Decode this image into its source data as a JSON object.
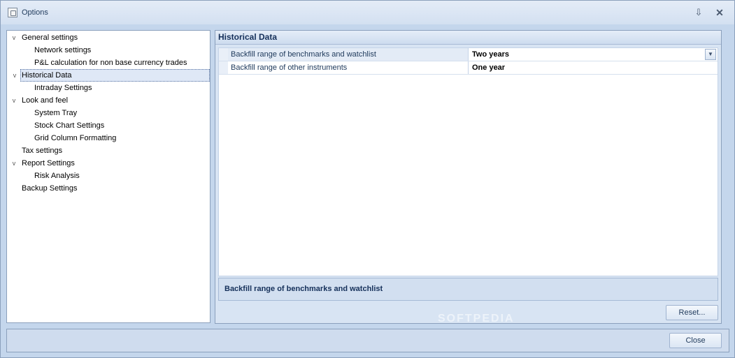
{
  "window": {
    "title": "Options",
    "pin_glyph": "⇩",
    "close_glyph": "✕"
  },
  "tree": {
    "items": [
      {
        "label": "General settings",
        "level": 0,
        "expanded": true
      },
      {
        "label": "Network settings",
        "level": 1
      },
      {
        "label": "P&L calculation for non base currency trades",
        "level": 1
      },
      {
        "label": "Historical Data",
        "level": 0,
        "expanded": true,
        "selected": true
      },
      {
        "label": "Intraday Settings",
        "level": 1
      },
      {
        "label": "Look and feel",
        "level": 0,
        "expanded": true
      },
      {
        "label": "System Tray",
        "level": 1
      },
      {
        "label": "Stock Chart Settings",
        "level": 1
      },
      {
        "label": "Grid Column Formatting",
        "level": 1
      },
      {
        "label": "Tax settings",
        "level": 0
      },
      {
        "label": "Report Settings",
        "level": 0,
        "expanded": true
      },
      {
        "label": "Risk Analysis",
        "level": 1
      },
      {
        "label": "Backup Settings",
        "level": 0
      }
    ],
    "chevron_glyph": "v"
  },
  "panel": {
    "header": "Historical Data",
    "rows": [
      {
        "name": "Backfill range of benchmarks and watchlist",
        "value": "Two years",
        "has_dropdown": true
      },
      {
        "name": "Backfill range of other instruments",
        "value": "One year",
        "has_dropdown": false
      }
    ],
    "dropdown_glyph": "▼",
    "description": "Backfill range of benchmarks and watchlist",
    "reset_label": "Reset..."
  },
  "footer": {
    "close_label": "Close"
  },
  "watermark": "SOFTPEDIA",
  "colors": {
    "frame": "#c4d6ec",
    "selected_bg": "#dfe8f6",
    "text_primary": "#1e395b"
  }
}
